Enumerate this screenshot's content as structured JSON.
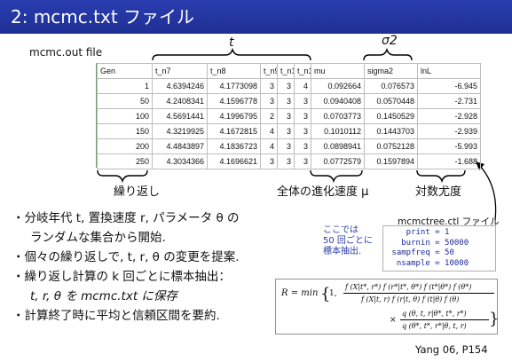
{
  "title": "2: mcmc.txt ファイル",
  "file_label": "mcmc.out file",
  "brace_labels": {
    "t": "t",
    "sigma": "σ2"
  },
  "table": {
    "headers": [
      "Gen",
      "t_n7",
      "t_n8",
      "t_n9",
      "t_n1",
      "t_n1",
      "mu",
      "sigma2",
      "lnL"
    ],
    "rows": [
      [
        "1",
        "4.6394246",
        "4.1773098",
        "3",
        "3",
        "4",
        "0.092664",
        "0.076573",
        "-6.945"
      ],
      [
        "50",
        "4.2408341",
        "4.1596778",
        "3",
        "3",
        "3",
        "0.0940408",
        "0.0570448",
        "-2.731"
      ],
      [
        "100",
        "4.5691441",
        "4.1996795",
        "2",
        "3",
        "3",
        "0.0703773",
        "0.1450529",
        "-2.928"
      ],
      [
        "150",
        "4.3219925",
        "4.1672815",
        "4",
        "3",
        "3",
        "0.1010112",
        "0.1443703",
        "-2.939"
      ],
      [
        "200",
        "4.4843897",
        "4.1836723",
        "4",
        "3",
        "3",
        "0.0898941",
        "0.0752128",
        "-5.993"
      ],
      [
        "250",
        "4.3034366",
        "4.1696621",
        "3",
        "3",
        "3",
        "0.0772579",
        "0.1597894",
        "-1.688"
      ]
    ]
  },
  "sub_labels": {
    "iterations": "繰り返し",
    "overall_rate": "全体の進化速度 μ",
    "log_likelihood": "対数尤度"
  },
  "bullets": [
    "・分岐年代 t, 置換速度 r, パラメータ θ の",
    "ランダムな集合から開始.",
    "・個々の繰り返しで, t, r, θ の変更を提案.",
    "・繰り返し計算の k 回ごとに標本抽出：",
    "t, r, θ を mcmc.txt に保存",
    "・計算終了時に平均と信頼区間を要約."
  ],
  "blue_note": [
    "ここでは",
    "50 回ごとに",
    "標本抽出."
  ],
  "ctl": {
    "title": "mcmctree.ctl ファイル",
    "lines": [
      "    print = 1",
      "   burnin = 50000",
      " sampfreq = 50",
      "  nsample = 10000"
    ]
  },
  "formula": {
    "lhs": "R = min",
    "part1_num": "f (X|t*, r*) f (r*|t*, θ*) f (t*|θ*) f (θ*)",
    "part1_den": "f (X|t, r) f (r|t, θ) f (t|θ) f (θ)",
    "part2_num": "q (θ, t, r|θ*, t*, r*)",
    "part2_den": "q (θ*, t*, r*|θ, t, r)",
    "times": "×",
    "one": "1,"
  },
  "citation": "Yang 06, P154",
  "colors": {
    "title_bar": "#1e2f93",
    "note_blue": "#2b3ca8"
  }
}
